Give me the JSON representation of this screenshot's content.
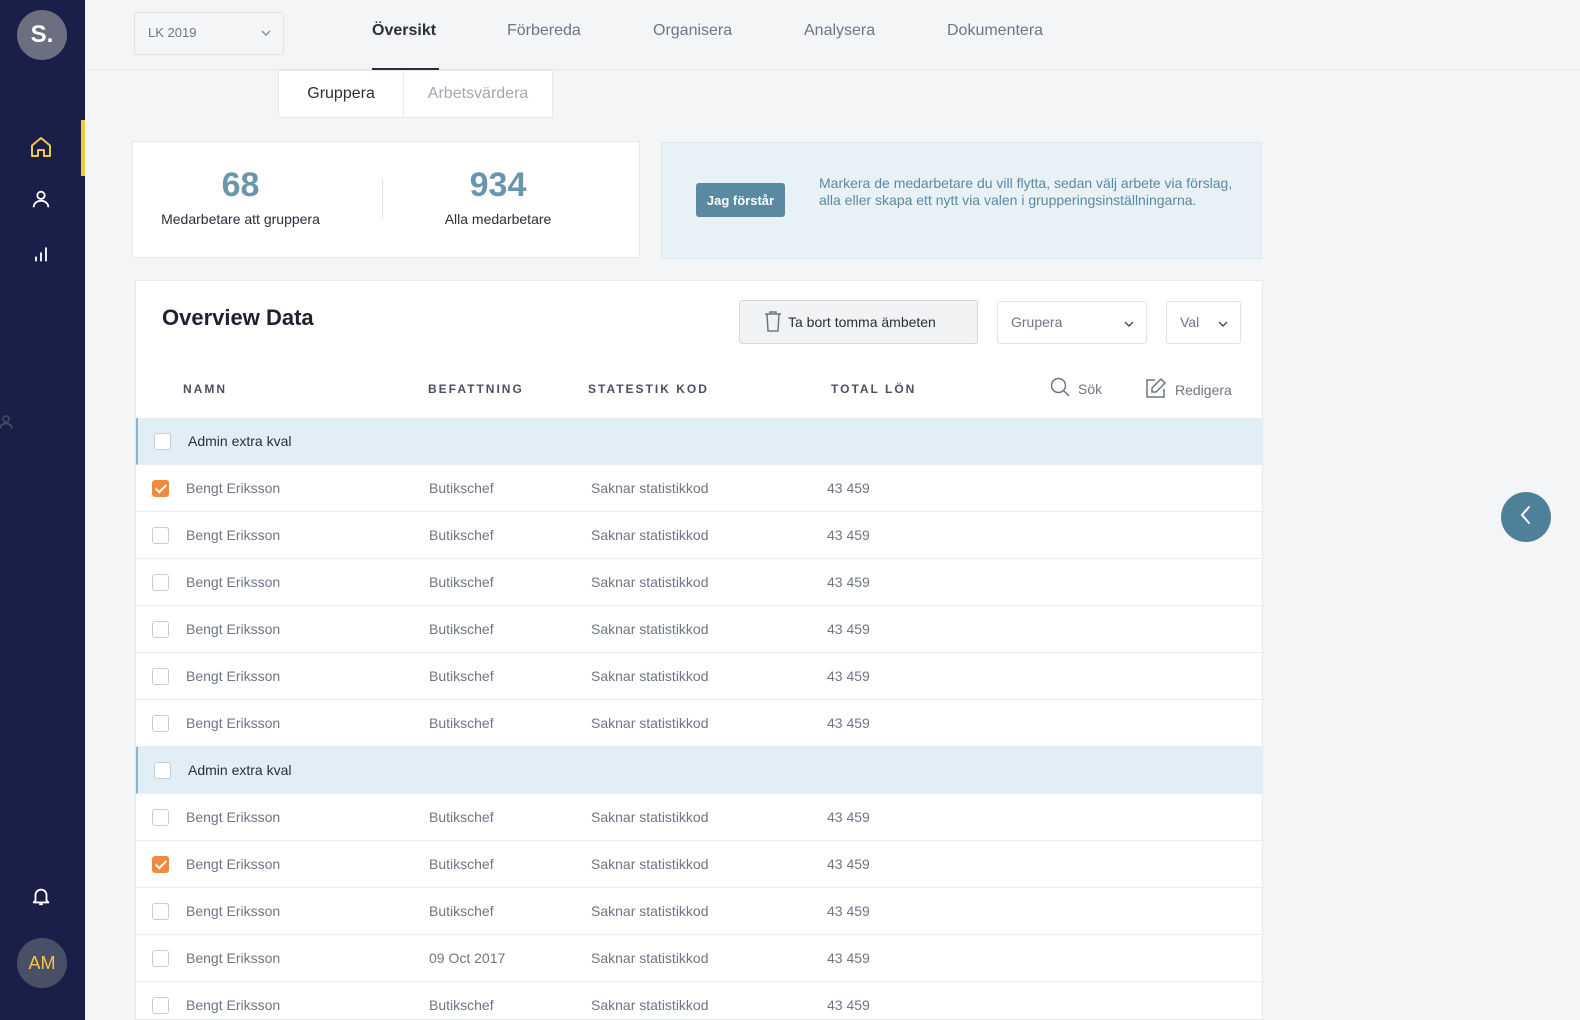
{
  "sidebar": {
    "brand": "S.",
    "user_initials": "AM",
    "nav_icons": [
      "home-icon",
      "user-icon",
      "bar-chart-icon"
    ],
    "bottom_icons": [
      "bell-icon"
    ],
    "accent": "#f6c744"
  },
  "topbar": {
    "period": "LK 2019",
    "tabs": [
      {
        "label": "Översikt",
        "active": true
      },
      {
        "label": "Förbereda"
      },
      {
        "label": "Organisera"
      },
      {
        "label": "Analysera"
      },
      {
        "label": "Dokumentera"
      }
    ]
  },
  "subtabs": [
    "Gruppera",
    "Arbetsvärdera"
  ],
  "stats": [
    {
      "value": "68",
      "label": "Medarbetare att gruppera"
    },
    {
      "value": "934",
      "label": "Alla medarbetare"
    }
  ],
  "info": {
    "button": "Jag förstår",
    "text": "Markera de medarbetare du vill flytta, sedan välj arbete via förslag, alla eller skapa ett nytt via valen i grupperingsinställningarna."
  },
  "card": {
    "title": "Overview Data",
    "delete_button": "Ta bort tomma ämbeten",
    "group_select": "Grupera",
    "val_select": "Val",
    "columns": [
      "NAMN",
      "BEFATTNING",
      "STATESTIK KOD",
      "TOTAL LÖN"
    ],
    "search_label": "Sök",
    "edit_label": "Redigera",
    "rows": [
      {
        "type": "group",
        "name": "Admin extra kval",
        "checked": false
      },
      {
        "type": "item",
        "name": "Bengt Eriksson",
        "title": "Butikschef",
        "code": "Saknar statistikkod",
        "salary": "43 459",
        "checked": true
      },
      {
        "type": "item",
        "name": "Bengt Eriksson",
        "title": "Butikschef",
        "code": "Saknar statistikkod",
        "salary": "43 459",
        "checked": false
      },
      {
        "type": "item",
        "name": "Bengt Eriksson",
        "title": "Butikschef",
        "code": "Saknar statistikkod",
        "salary": "43 459",
        "checked": false
      },
      {
        "type": "item",
        "name": "Bengt Eriksson",
        "title": "Butikschef",
        "code": "Saknar statistikkod",
        "salary": "43 459",
        "checked": false
      },
      {
        "type": "item",
        "name": "Bengt Eriksson",
        "title": "Butikschef",
        "code": "Saknar statistikkod",
        "salary": "43 459",
        "checked": false
      },
      {
        "type": "item",
        "name": "Bengt Eriksson",
        "title": "Butikschef",
        "code": "Saknar statistikkod",
        "salary": "43 459",
        "checked": false
      },
      {
        "type": "group",
        "name": "Admin extra kval",
        "checked": false
      },
      {
        "type": "item",
        "name": "Bengt Eriksson",
        "title": "Butikschef",
        "code": "Saknar statistikkod",
        "salary": "43 459",
        "checked": false
      },
      {
        "type": "item",
        "name": "Bengt Eriksson",
        "title": "Butikschef",
        "code": "Saknar statistikkod",
        "salary": "43 459",
        "checked": true
      },
      {
        "type": "item",
        "name": "Bengt Eriksson",
        "title": "Butikschef",
        "code": "Saknar statistikkod",
        "salary": "43 459",
        "checked": false
      },
      {
        "type": "item",
        "name": "Bengt Eriksson",
        "title": "09 Oct 2017",
        "code": "Saknar statistikkod",
        "salary": "43 459",
        "checked": false
      },
      {
        "type": "item",
        "name": "Bengt Eriksson",
        "title": "Butikschef",
        "code": "Saknar statistikkod",
        "salary": "43 459",
        "checked": false
      }
    ]
  },
  "colors": {
    "sidebar": "#1a1f4a",
    "stat_number": "#6a96ad",
    "checkbox_checked": "#f08a3e",
    "group_row": "#e2eef5"
  }
}
